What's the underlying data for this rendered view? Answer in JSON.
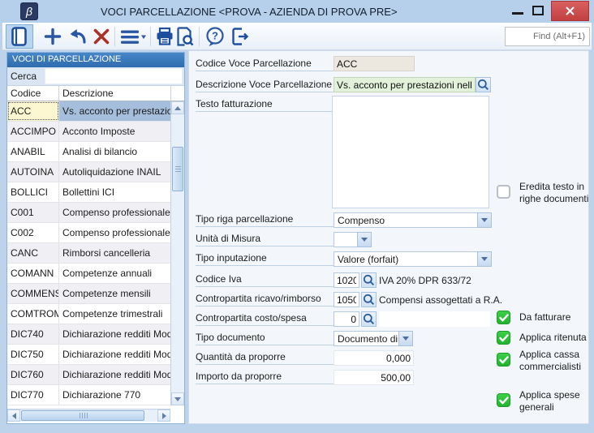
{
  "window": {
    "title": "VOCI PARCELLAZIONE <PROVA - AZIENDA DI PROVA PRE>",
    "app_icon_glyph": "β",
    "controls": [
      "minimize",
      "maximize",
      "close"
    ]
  },
  "toolbar": {
    "buttons": [
      "records-panel",
      "add-record",
      "undo",
      "delete-record",
      "menu",
      "print",
      "print-preview",
      "help",
      "exit"
    ],
    "find_placeholder": "Find (Alt+F1)"
  },
  "sidebar": {
    "header": "VOCI DI PARCELLAZIONE",
    "search_label": "Cerca",
    "search_value": "",
    "columns": {
      "code": "Codice",
      "desc": "Descrizione"
    },
    "rows": [
      {
        "code": "ACC",
        "desc": "Vs. acconto per prestazio.",
        "selected": true
      },
      {
        "code": "ACCIMPO",
        "desc": "Acconto Imposte",
        "selected": false
      },
      {
        "code": "ANABIL",
        "desc": "Analisi di bilancio",
        "selected": false
      },
      {
        "code": "AUTOINA",
        "desc": "Autoliquidazione INAIL",
        "selected": false
      },
      {
        "code": "BOLLICI",
        "desc": "Bollettini ICI",
        "selected": false
      },
      {
        "code": "C001",
        "desc": "Compenso professionale ..",
        "selected": false
      },
      {
        "code": "C002",
        "desc": "Compenso professionale ..",
        "selected": false
      },
      {
        "code": "CANC",
        "desc": "Rimborsi cancelleria",
        "selected": false
      },
      {
        "code": "COMANN",
        "desc": "Competenze annuali",
        "selected": false
      },
      {
        "code": "COMMENS",
        "desc": "Competenze mensili",
        "selected": false
      },
      {
        "code": "COMTROM",
        "desc": "Competenze trimestrali",
        "selected": false
      },
      {
        "code": "DIC740",
        "desc": "Dichiarazione redditi Mod..",
        "selected": false
      },
      {
        "code": "DIC750",
        "desc": "Dichiarazione redditi Mod..",
        "selected": false
      },
      {
        "code": "DIC760",
        "desc": "Dichiarazione redditi Mod..",
        "selected": false
      },
      {
        "code": "DIC770",
        "desc": "Dichiarazione 770",
        "selected": false
      }
    ]
  },
  "form": {
    "fields": {
      "codice_voce": {
        "label": "Codice Voce Parcellazione",
        "value": "ACC"
      },
      "descrizione_voce": {
        "label": "Descrizione Voce Parcellazione",
        "value": "Vs. acconto per prestazioni nell'anno"
      },
      "testo_fatturazione": {
        "label": "Testo fatturazione",
        "value": ""
      },
      "tipo_riga": {
        "label": "Tipo riga parcellazione",
        "value": "Compenso"
      },
      "unita_misura": {
        "label": "Unità di Misura",
        "value": ""
      },
      "tipo_inputazione": {
        "label": "Tipo inputazione",
        "value": "Valore (forfait)"
      },
      "codice_iva": {
        "label": "Codice Iva",
        "value": "1020",
        "description": "IVA 20% DPR 633/72"
      },
      "contropartita_ricavo": {
        "label": "Contropartita ricavo/rimborso",
        "value": "1050",
        "description": "Compensi assogettati a R.A."
      },
      "contropartita_costo": {
        "label": "Contropartita costo/spesa",
        "value": "0",
        "description": ""
      },
      "tipo_documento": {
        "label": "Tipo documento",
        "value": "Documento di..."
      },
      "quantita": {
        "label": "Quantità da proporre",
        "value": "0,000"
      },
      "importo": {
        "label": "Importo da proporre",
        "value": "500,00"
      }
    },
    "checkboxes": [
      {
        "label": "Eredita testo in righe documenti",
        "checked": false
      },
      {
        "label": "Da fatturare",
        "checked": true
      },
      {
        "label": "Applica ritenuta",
        "checked": true
      },
      {
        "label": "Applica cassa commercialisti",
        "checked": true
      },
      {
        "label": "Applica spese generali",
        "checked": true
      }
    ]
  },
  "colors": {
    "titlebar": "#b6cfea",
    "frame": "#bdd3ec",
    "panel_header_blue": "#3878b9",
    "selected_row": "#a5bedb",
    "selected_code_yellow": "#fcf7d1",
    "input_green": "#e2f1da",
    "input_readonly": "#ece8df",
    "checkbox_green": "#2fc13a",
    "close_red": "#c94d4d",
    "icon_blue": "#1d4f9e",
    "delete_red": "#a93226"
  }
}
